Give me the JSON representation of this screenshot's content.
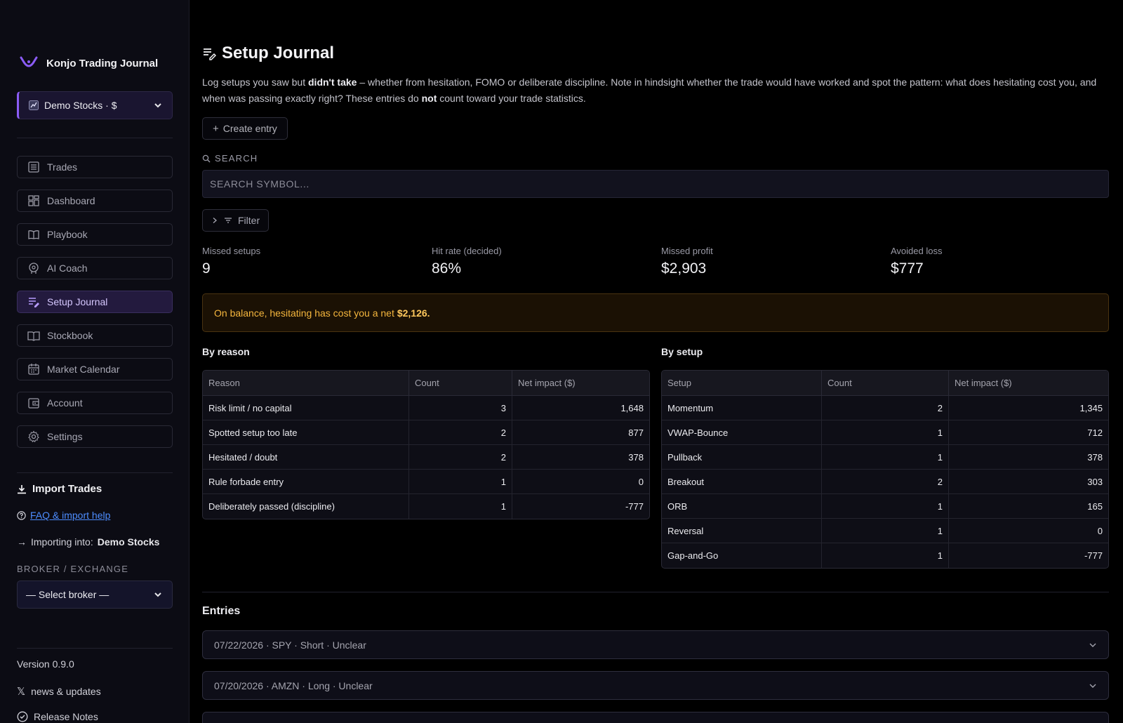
{
  "app": {
    "name": "Konjo Trading Journal"
  },
  "sidebar": {
    "account": "Demo Stocks · $",
    "nav": [
      {
        "label": "Trades",
        "icon": "list-icon"
      },
      {
        "label": "Dashboard",
        "icon": "dashboard-icon"
      },
      {
        "label": "Playbook",
        "icon": "book-open-icon"
      },
      {
        "label": "AI Coach",
        "icon": "brain-icon"
      },
      {
        "label": "Setup Journal",
        "icon": "journal-edit-icon",
        "active": true
      },
      {
        "label": "Stockbook",
        "icon": "book-icon"
      },
      {
        "label": "Market Calendar",
        "icon": "calendar-icon"
      },
      {
        "label": "Account",
        "icon": "wallet-icon"
      },
      {
        "label": "Settings",
        "icon": "gear-icon"
      }
    ],
    "import": {
      "title": "Import Trades",
      "faq": "FAQ & import help",
      "importing_prefix": "Importing into:",
      "importing_target": "Demo Stocks",
      "broker_label": "BROKER / EXCHANGE",
      "broker_value": "— Select broker —"
    },
    "version": "Version 0.9.0",
    "news": "news & updates",
    "release": "Release Notes"
  },
  "page": {
    "title": "Setup Journal",
    "desc": {
      "p1": "Log setups you saw but ",
      "b1": "didn't take",
      "p2": " – whether from hesitation, FOMO or deliberate discipline. Note in hindsight whether the trade would have worked and spot the pattern: what does hesitating cost you, and when was passing exactly right? These entries do ",
      "b2": "not",
      "p3": " count toward your trade statistics."
    },
    "create_label": "Create entry",
    "search_label": "SEARCH",
    "search_placeholder": "SEARCH SYMBOL...",
    "filter_label": "Filter"
  },
  "stats": [
    {
      "label": "Missed setups",
      "value": "9"
    },
    {
      "label": "Hit rate (decided)",
      "value": "86%"
    },
    {
      "label": "Missed profit",
      "value": "$2,903"
    },
    {
      "label": "Avoided loss",
      "value": "$777"
    }
  ],
  "banner": {
    "text": "On balance, hesitating has cost you a net",
    "amount": "$2,126."
  },
  "by_reason": {
    "title": "By reason",
    "headers": [
      "Reason",
      "Count",
      "Net impact ($)"
    ],
    "rows": [
      [
        "Risk limit / no capital",
        "3",
        "1,648"
      ],
      [
        "Spotted setup too late",
        "2",
        "877"
      ],
      [
        "Hesitated / doubt",
        "2",
        "378"
      ],
      [
        "Rule forbade entry",
        "1",
        "0"
      ],
      [
        "Deliberately passed (discipline)",
        "1",
        "-777"
      ]
    ]
  },
  "by_setup": {
    "title": "By setup",
    "headers": [
      "Setup",
      "Count",
      "Net impact ($)"
    ],
    "rows": [
      [
        "Momentum",
        "2",
        "1,345"
      ],
      [
        "VWAP-Bounce",
        "1",
        "712"
      ],
      [
        "Pullback",
        "1",
        "378"
      ],
      [
        "Breakout",
        "2",
        "303"
      ],
      [
        "ORB",
        "1",
        "165"
      ],
      [
        "Reversal",
        "1",
        "0"
      ],
      [
        "Gap-and-Go",
        "1",
        "-777"
      ]
    ]
  },
  "entries": {
    "title": "Entries",
    "items": [
      "07/22/2026 · SPY · Short · Unclear",
      "07/20/2026 · AMZN · Long · Unclear",
      ""
    ]
  },
  "colors": {
    "accent": "#8b5cf6",
    "warning": "#f5b63d",
    "link": "#4d8dff"
  }
}
